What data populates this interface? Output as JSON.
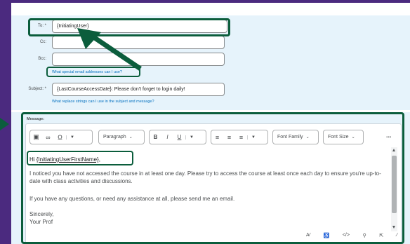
{
  "form": {
    "to_label": "To: *",
    "to_value": "{InitiatingUser}",
    "cc_label": "Cc:",
    "cc_value": "",
    "bcc_label": "Bcc:",
    "bcc_value": "",
    "special_email_link": "What special email addresses can I use?",
    "subject_label": "Subject: *",
    "subject_value": "{LastCourseAccessDate}:  Please don't forget to login daily!",
    "replace_strings_link": "What replace strings can I use in the subject and message?",
    "message_label": "Message:"
  },
  "toolbar": {
    "paragraph": "Paragraph",
    "bold": "B",
    "italic": "I",
    "underline": "U",
    "font_family": "Font Family",
    "font_size": "Font Size",
    "more": "..."
  },
  "message": {
    "greeting_prefix": "Hi ",
    "greeting_token": "{InitiatingUserFirstName}",
    "greeting_suffix": ",",
    "p1": "I noticed you have not accessed the course in at least one day.  Please try to access the course at least once each day to ensure you're up-to-date with class activities and discussions.",
    "p2": "If you have any questions, or need any assistance at all, please send me an email.",
    "closing": "Sincerely,",
    "signature": "Your Prof"
  },
  "colors": {
    "annotation_green": "#0b5d3c",
    "background_purple": "#4b2a7f",
    "field_band": "#e6f3fb",
    "link": "#006fbf"
  },
  "icons": {
    "annotation_arrow": "arrow-icon",
    "annotation_pointer": "triangle-pointer-icon"
  }
}
